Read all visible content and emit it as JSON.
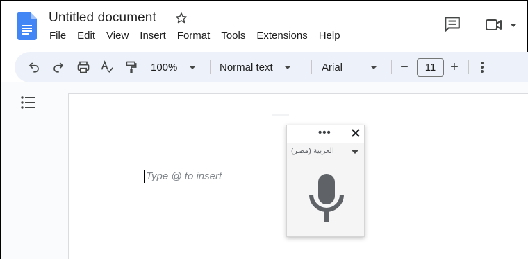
{
  "header": {
    "doc_title": "Untitled document",
    "menu": [
      "File",
      "Edit",
      "View",
      "Insert",
      "Format",
      "Tools",
      "Extensions",
      "Help"
    ]
  },
  "toolbar": {
    "zoom": "100%",
    "style": "Normal text",
    "font": "Arial",
    "font_size": "11",
    "minus": "−",
    "plus": "+"
  },
  "document": {
    "placeholder": "Type @ to insert"
  },
  "voice_panel": {
    "more": "•••",
    "language": "العربية (مصر)"
  },
  "colors": {
    "docs_blue": "#4285f4",
    "toolbar_bg": "#edf2fa",
    "mic_gray": "#5f6368"
  },
  "icons": [
    "docs-logo-icon",
    "star-icon",
    "comment-icon",
    "meet-icon",
    "undo-icon",
    "redo-icon",
    "print-icon",
    "spellcheck-icon",
    "paint-format-icon",
    "outline-icon",
    "close-icon",
    "microphone-icon"
  ]
}
